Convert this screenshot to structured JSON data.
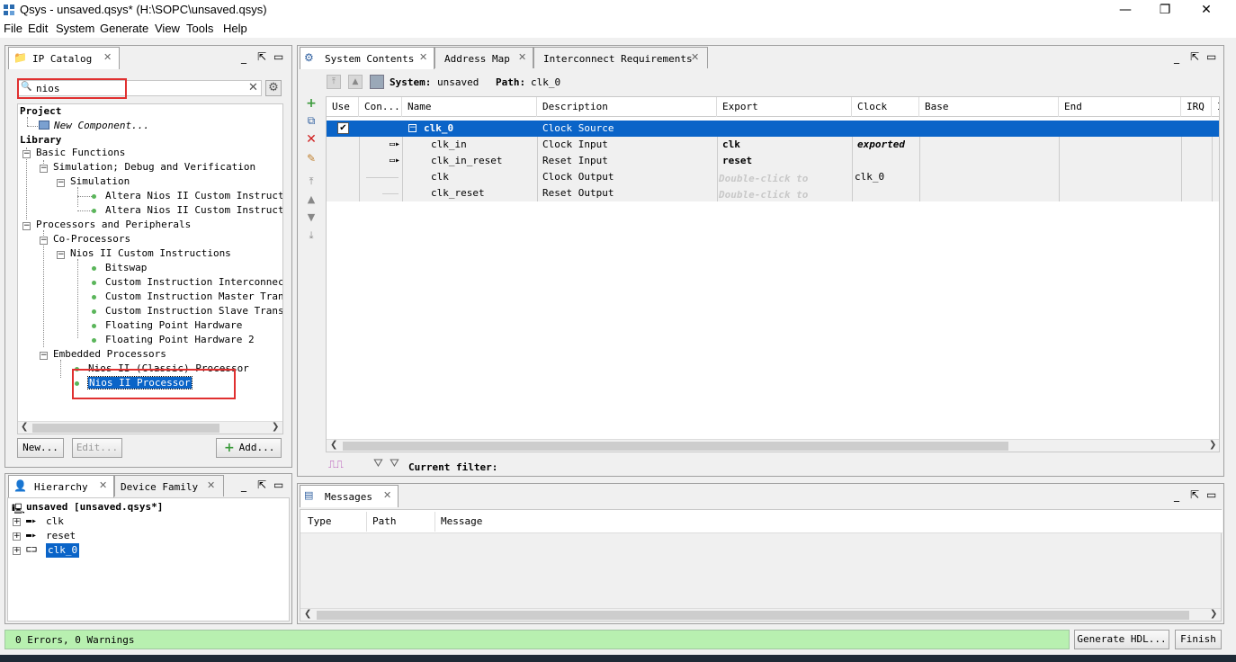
{
  "window": {
    "title": "Qsys - unsaved.qsys* (H:\\SOPC\\unsaved.qsys)"
  },
  "menu": [
    "File",
    "Edit",
    "System",
    "Generate",
    "View",
    "Tools",
    "Help"
  ],
  "ip_catalog": {
    "tab_label": "IP Catalog",
    "search_value": "nios",
    "tree": {
      "project": "Project",
      "new_component": "New Component...",
      "library": "Library",
      "basic_functions": "Basic Functions",
      "sim_debug": "Simulation; Debug and Verification",
      "simulation": "Simulation",
      "altera_ci_1": "Altera Nios II Custom Instruction",
      "altera_ci_2": "Altera Nios II Custom Instruction",
      "proc_periph": "Processors and Peripherals",
      "co_processors": "Co-Processors",
      "nios_ci": "Nios II Custom Instructions",
      "bitswap": "Bitswap",
      "ci_interconnect": "Custom Instruction Interconnect",
      "ci_master": "Custom Instruction Master Transla",
      "ci_slave": "Custom Instruction Slave Translat",
      "fp_hw": "Floating Point Hardware",
      "fp_hw2": "Floating Point Hardware 2",
      "embedded": "Embedded Processors",
      "nios_classic": "Nios II (Classic) Processor",
      "nios_proc": "Nios II Processor"
    },
    "buttons": {
      "new": "New...",
      "edit": "Edit...",
      "add": "Add..."
    }
  },
  "hierarchy": {
    "tab_label": "Hierarchy",
    "tab2_label": "Device Family",
    "root": "unsaved [unsaved.qsys*]",
    "items": [
      "clk",
      "reset",
      "clk_0"
    ]
  },
  "system_contents": {
    "tabs": [
      "System Contents",
      "Address Map",
      "Interconnect Requirements"
    ],
    "system_label": "System:",
    "system_value": "unsaved",
    "path_label": "Path:",
    "path_value": "clk_0",
    "columns": [
      "Use",
      "Con...",
      "Name",
      "Description",
      "Export",
      "Clock",
      "Base",
      "End",
      "IRQ",
      "I"
    ],
    "rows": [
      {
        "name": "clk_0",
        "description": "Clock Source",
        "export": "",
        "clock": ""
      },
      {
        "name": "clk_in",
        "description": "Clock Input",
        "export": "clk",
        "clock": "exported"
      },
      {
        "name": "clk_in_reset",
        "description": "Reset Input",
        "export": "reset",
        "clock": ""
      },
      {
        "name": "clk",
        "description": "Clock Output",
        "export": "Double-click to",
        "clock": "clk_0"
      },
      {
        "name": "clk_reset",
        "description": "Reset Output",
        "export": "Double-click to",
        "clock": ""
      }
    ],
    "filter_label": "Current filter:"
  },
  "messages": {
    "tab_label": "Messages",
    "columns": [
      "Type",
      "Path",
      "Message"
    ]
  },
  "status": {
    "text": "0 Errors, 0 Warnings",
    "generate_label": "Generate HDL...",
    "finish_label": "Finish"
  },
  "colors": {
    "selection": "#0a64c8",
    "status_bg": "#b8f0b0",
    "highlight_box": "#e03030"
  }
}
